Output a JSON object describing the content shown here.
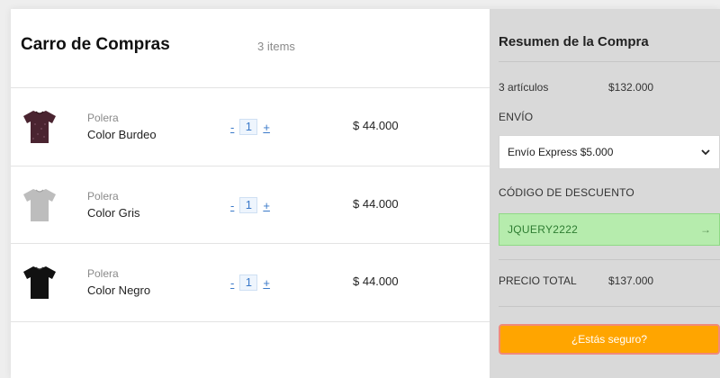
{
  "cart": {
    "title": "Carro de Compras",
    "count": "3 items",
    "items": [
      {
        "name": "Polera",
        "color": "Color Burdeo",
        "qty": "1",
        "price": "$ 44.000",
        "minus": "-",
        "plus": "+",
        "shirt_color": "#4a2430"
      },
      {
        "name": "Polera",
        "color": "Color Gris",
        "qty": "1",
        "price": "$ 44.000",
        "minus": "-",
        "plus": "+",
        "shirt_color": "#bdbdbd"
      },
      {
        "name": "Polera",
        "color": "Color Negro",
        "qty": "1",
        "price": "$ 44.000",
        "minus": "-",
        "plus": "+",
        "shirt_color": "#111111"
      }
    ]
  },
  "summary": {
    "title": "Resumen de la Compra",
    "articles_label": "3 artículos",
    "articles_value": "$132.000",
    "shipping_label": "ENVÍO",
    "shipping_selected": "Envío Express $5.000",
    "discount_label": "CÓDIGO DE DESCUENTO",
    "discount_code": "JQUERY2222",
    "discount_arrow": "→",
    "total_label": "PRECIO TOTAL",
    "total_value": "$137.000",
    "confirm_label": "¿Estás seguro?"
  },
  "colors": {
    "accent_link": "#3a79c9",
    "confirm_bg": "#ffa500",
    "code_bg": "#b6ecad",
    "summary_bg": "#d9d9d9"
  }
}
